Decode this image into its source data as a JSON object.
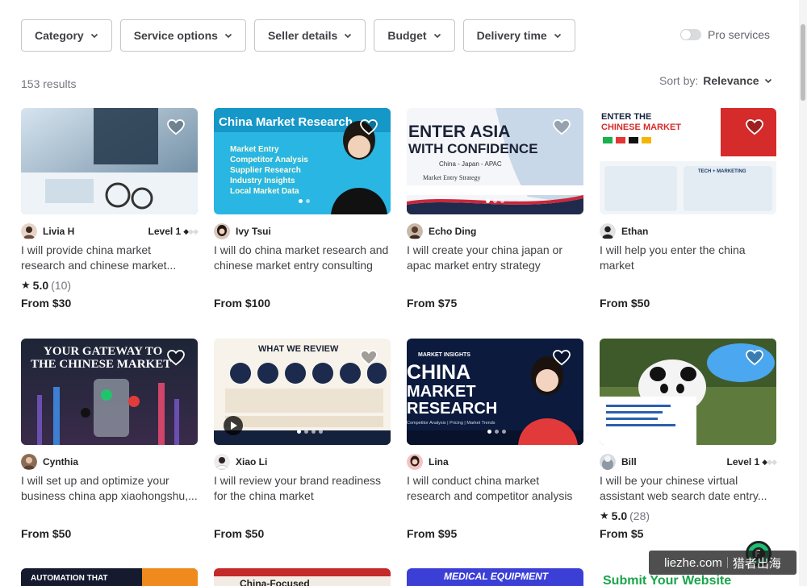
{
  "filters": [
    {
      "label": "Category"
    },
    {
      "label": "Service options"
    },
    {
      "label": "Seller details"
    },
    {
      "label": "Budget"
    },
    {
      "label": "Delivery time"
    }
  ],
  "pro_services": {
    "label": "Pro services",
    "enabled": false
  },
  "results": {
    "count_text": "153 results"
  },
  "sort": {
    "label": "Sort by:",
    "value": "Relevance"
  },
  "gigs": [
    {
      "seller": "Livia H",
      "level": "Level 1",
      "title": "I will provide china market research and chinese market...",
      "rating": "5.0",
      "reviews": "(10)",
      "price": "From $30",
      "image_text": []
    },
    {
      "seller": "Ivy Tsui",
      "level": "",
      "title": "I will do china market research and chinese market entry consulting",
      "rating": "",
      "reviews": "",
      "price": "From $100",
      "image_text": [
        "China Market Research",
        "Market Entry",
        "Competitor Analysis",
        "Supplier Research",
        "Industry Insights",
        "Local Market Data"
      ]
    },
    {
      "seller": "Echo Ding",
      "level": "",
      "title": "I will create your china japan or apac market entry strategy",
      "rating": "",
      "reviews": "",
      "price": "From $75",
      "image_text": [
        "ENTER ASIA",
        "WITH CONFIDENCE",
        "China - Japan - APAC",
        "Market Entry Strategy"
      ]
    },
    {
      "seller": "Ethan",
      "level": "",
      "title": "I will help you enter the china market",
      "rating": "",
      "reviews": "",
      "price": "From $50",
      "image_text": [
        "ENTER THE",
        "CHINESE MARKET",
        "TECH + MARKETING"
      ]
    },
    {
      "seller": "Cynthia",
      "level": "",
      "title": "I will set up and optimize your business china app xiaohongshu,...",
      "rating": "",
      "reviews": "",
      "price": "From $50",
      "image_text": [
        "YOUR GATEWAY TO",
        "THE CHINESE MARKET"
      ]
    },
    {
      "seller": "Xiao Li",
      "level": "",
      "title": "I will review your brand readiness for the china market",
      "rating": "",
      "reviews": "",
      "price": "From $50",
      "image_text": [
        "WHAT WE REVIEW"
      ]
    },
    {
      "seller": "Lina",
      "level": "",
      "title": "I will conduct china market research and competitor analysis",
      "rating": "",
      "reviews": "",
      "price": "From $95",
      "image_text": [
        "MARKET INSIGHTS",
        "CHINA",
        "MARKET",
        "RESEARCH",
        "Competitor Analysis | Pricing | Market Trends"
      ]
    },
    {
      "seller": "Bill",
      "level": "Level 1",
      "title": "I will be your chinese virtual assistant web search date entry...",
      "rating": "5.0",
      "reviews": "(28)",
      "price": "From $5",
      "image_text": []
    }
  ],
  "bottom_row": [
    {
      "image_text": "AUTOMATION THAT"
    },
    {
      "image_text": "China-Focused"
    },
    {
      "image_text": "MEDICAL EQUIPMENT"
    },
    {
      "image_text": "Submit Your Website"
    }
  ],
  "watermark": {
    "left": "liezhe.com",
    "right": "猎者出海"
  },
  "colors": {
    "text": "#404145",
    "muted": "#74767e",
    "border": "#c5c6c9",
    "brand_green": "#1dbf73"
  }
}
